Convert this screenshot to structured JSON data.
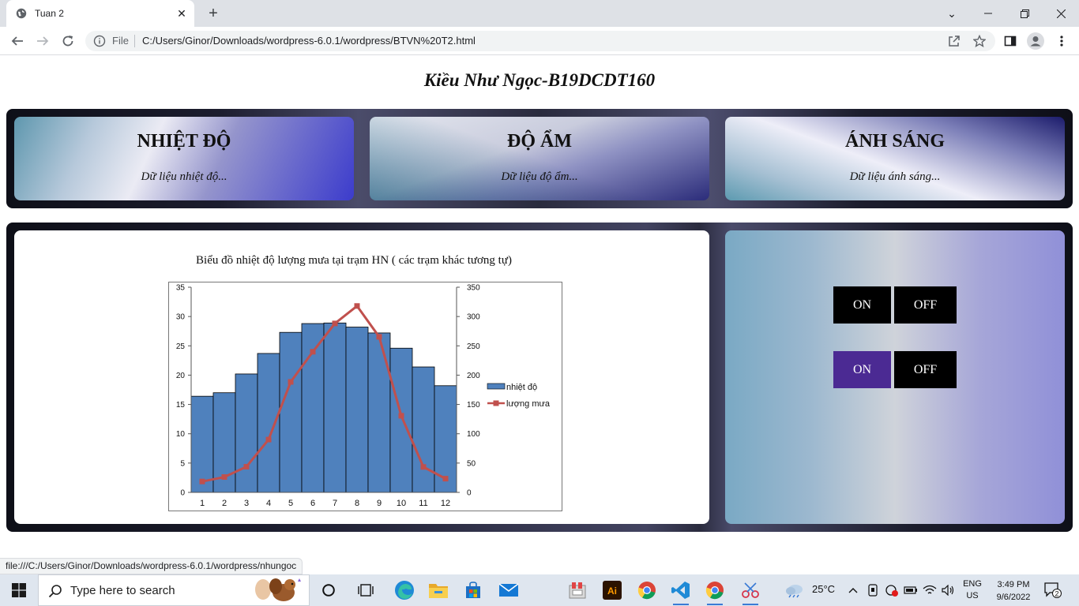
{
  "browser": {
    "tab_title": "Tuan 2",
    "address_scheme": "File",
    "address_url": "C:/Users/Ginor/Downloads/wordpress-6.0.1/wordpress/BTVN%20T2.html",
    "status_url": "file:///C:/Users/Ginor/Downloads/wordpress-6.0.1/wordpress/nhungoc"
  },
  "page": {
    "title": "Kiều Như Ngọc-B19DCDT160",
    "sensors": [
      {
        "heading": "NHIỆT ĐỘ",
        "value": "Dữ liệu nhiệt độ..."
      },
      {
        "heading": "ĐỘ ẨM",
        "value": "Dữ liệu độ ẩm..."
      },
      {
        "heading": "ÁNH SÁNG",
        "value": "Dữ liệu ánh sáng..."
      }
    ],
    "chart_title": "Biểu đồ nhiệt độ lượng mưa tại trạm HN ( các trạm khác tương tự)",
    "controls": [
      {
        "on": "ON",
        "off": "OFF",
        "state": "off",
        "on_color": "#000000"
      },
      {
        "on": "ON",
        "off": "OFF",
        "state": "on",
        "on_color": "#4b2a93"
      }
    ]
  },
  "chart_data": {
    "type": "bar",
    "categories": [
      "1",
      "2",
      "3",
      "4",
      "5",
      "6",
      "7",
      "8",
      "9",
      "10",
      "11",
      "12"
    ],
    "series": [
      {
        "name": "nhiệt độ",
        "type": "bar",
        "axis": "left",
        "color": "#4f81bd",
        "values": [
          16.4,
          17.0,
          20.2,
          23.7,
          27.3,
          28.8,
          28.9,
          28.2,
          27.2,
          24.6,
          21.4,
          18.2
        ]
      },
      {
        "name": "lượng mưa",
        "type": "line",
        "axis": "right",
        "color": "#c0504d",
        "values": [
          18.6,
          26.2,
          43.8,
          90.1,
          188.5,
          239.9,
          288.2,
          318.0,
          265.4,
          130.7,
          43.4,
          23.4
        ]
      }
    ],
    "y_left": {
      "min": 0,
      "max": 35,
      "ticks": [
        "0",
        "5",
        "10",
        "15",
        "20",
        "25",
        "30",
        "35"
      ]
    },
    "y_right": {
      "min": 0,
      "max": 350,
      "ticks": [
        "0",
        "50",
        "100",
        "150",
        "200",
        "250",
        "300",
        "350"
      ]
    },
    "legend_position": "right",
    "grid": false
  },
  "taskbar": {
    "search_placeholder": "Type here to search",
    "weather": "25°C",
    "lang_line1": "ENG",
    "lang_line2": "US",
    "time": "3:49 PM",
    "date": "9/6/2022",
    "notifications": "2"
  }
}
